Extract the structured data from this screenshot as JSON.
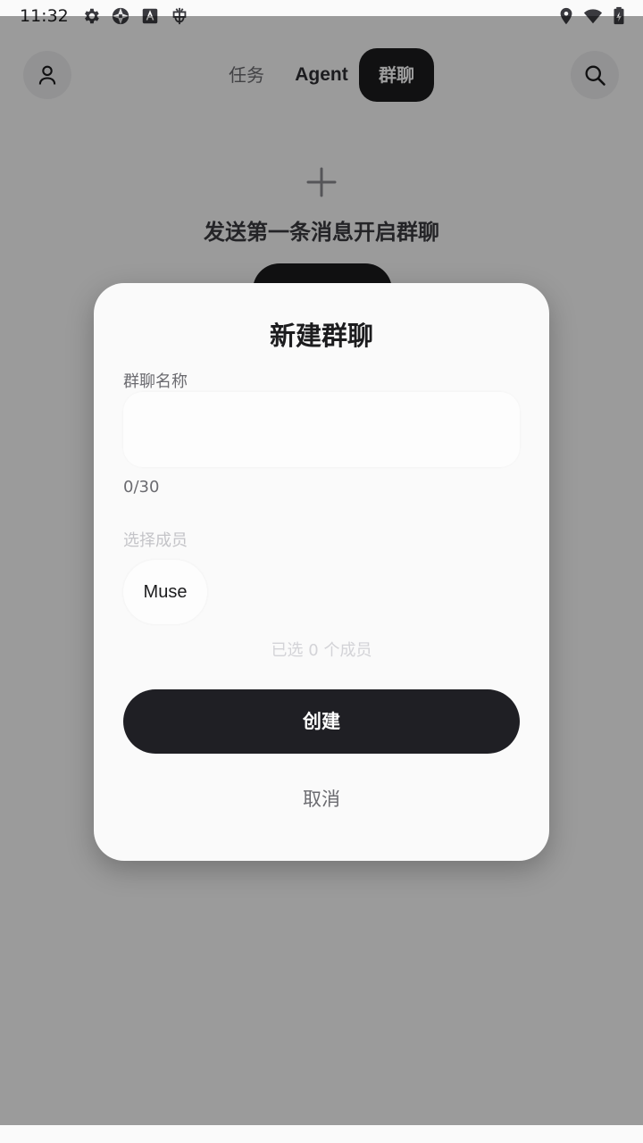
{
  "status_bar": {
    "time": "11:32",
    "left_icons": [
      "gear-icon",
      "aperture-icon",
      "font-icon",
      "bug-icon"
    ],
    "right_icons": [
      "location-icon",
      "wifi-icon",
      "battery-icon"
    ]
  },
  "header": {
    "tabs": [
      {
        "label": "任务",
        "active": false
      },
      {
        "label": "Agent",
        "active": false
      },
      {
        "label": "群聊",
        "active": true
      }
    ]
  },
  "empty_state": {
    "message": "发送第一条消息开启群聊"
  },
  "dialog": {
    "title": "新建群聊",
    "name_label": "群聊名称",
    "name_value": "",
    "name_placeholder": "",
    "char_counter": "0/30",
    "members_label": "选择成员",
    "members": [
      "Muse"
    ],
    "selected_count_text": "已选 0 个成员",
    "create_label": "创建",
    "cancel_label": "取消"
  },
  "colors": {
    "primary": "#1c1c1e",
    "background": "#fafafa",
    "muted_text": "#6b6b70"
  }
}
